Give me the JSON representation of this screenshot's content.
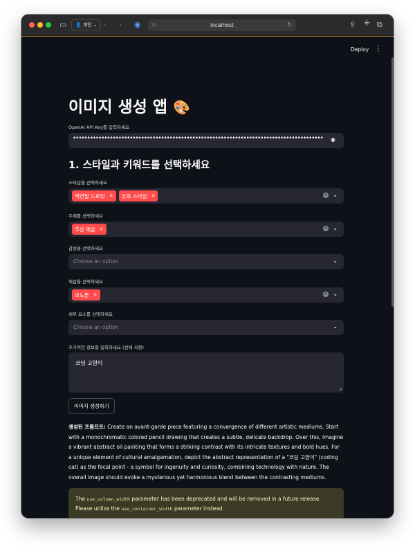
{
  "browser": {
    "profile_label": "개인",
    "url": "localhost"
  },
  "header": {
    "deploy_label": "Deploy"
  },
  "main": {
    "title": "이미지 생성 앱",
    "title_emoji": "🎨",
    "api_key_label": "OpenAI API Key를 입력하세요",
    "api_key_value": "••••••••••••••••••••••••••••••••••••••••••••••••••••••••••••••••••••••••••••••••••••••••",
    "section_heading": "1. 스타일과 키워드를 선택하세요",
    "style_label": "스타일을 선택하세요",
    "style_tags": [
      "색연필 드로잉",
      "유화 스타일"
    ],
    "subject_label": "주제를 선택하세요",
    "subject_tags": [
      "추상 예술"
    ],
    "emotion_label": "감성을 선택하세요",
    "emotion_placeholder": "Choose an option",
    "color_label": "색감을 선택하세요",
    "color_tags": [
      "모노톤"
    ],
    "detail_label": "세부 요소를 선택하세요",
    "detail_placeholder": "Choose an option",
    "extra_label": "추가적인 정보를 입력하세요 (선택 사항)",
    "extra_value": "코딩 고양이",
    "generate_button": "이미지 생성하기",
    "prompt_label": "생성된 프롬프트:",
    "prompt_text": " Create an avant-garde piece featuring a convergence of different artistic mediums. Start with a monochromatic colored pencil drawing that creates a subtle, delicate backdrop. Over this, imagine a vibrant abstract oil painting that forms a striking contrast with its intricate textures and bold hues. For a unique element of cultural amalgamation, depict the abstract representation of a \"코딩 고양이\" (coding cat) as the focal point - a symbol for ingenuity and curiosity, combining technology with nature. The overall image should evoke a mysterious yet harmonious blend between the contrasting mediums.",
    "warning_prefix": "The ",
    "warning_code1": "use_column_width",
    "warning_mid": " parameter has been deprecated and will be removed in a future release. Please utilize the ",
    "warning_code2": "use_container_width",
    "warning_suffix": " parameter instead."
  },
  "colors": {
    "background": "#0e1117",
    "widget": "#262730",
    "tag": "#ff4b4b",
    "warning_bg": "#3a3a25",
    "warning_text": "#fff6c2"
  },
  "icons": [
    "sidebar-icon",
    "back-icon",
    "forward-icon",
    "shield-icon",
    "eye-icon",
    "chevron-down-icon",
    "clear-icon",
    "share-icon",
    "new-tab-icon",
    "tabs-icon",
    "kebab-menu-icon"
  ]
}
